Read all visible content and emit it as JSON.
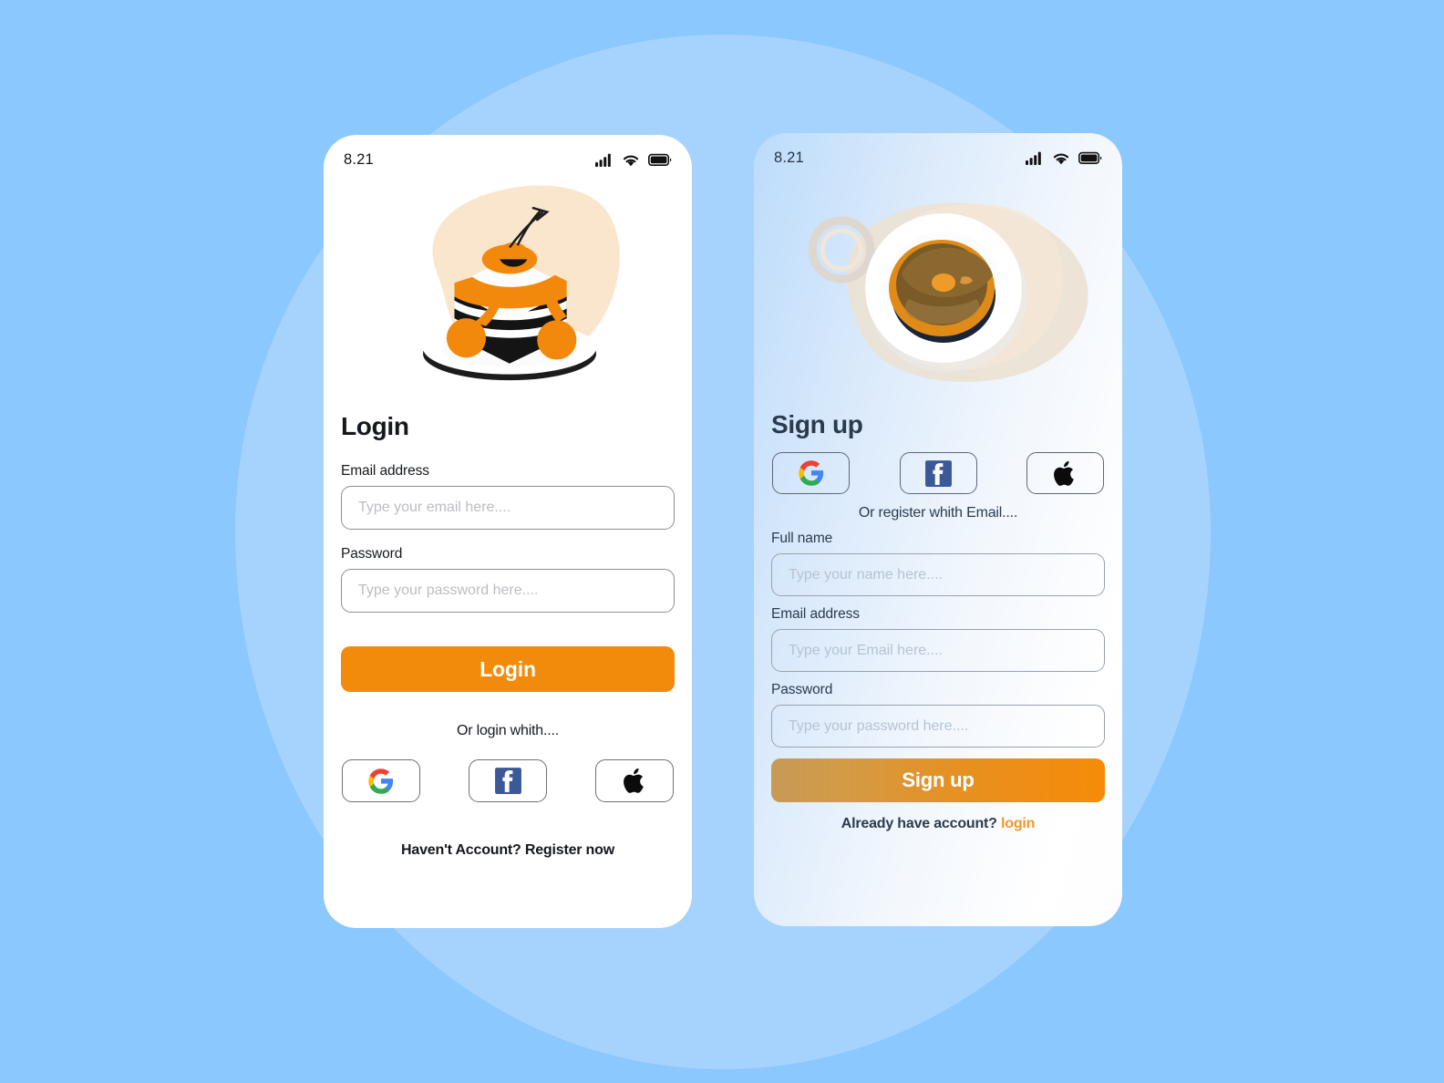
{
  "theme": {
    "page_background": "#8ac8fd",
    "background_blob": "#a5d3fd",
    "accent_orange": "#f28b0c",
    "link_orange": "#f5972a",
    "login_text": "#15181d",
    "signup_text": "#2b3b4e"
  },
  "login_screen": {
    "status_bar": {
      "time": "8.21",
      "icons": [
        "cellular-signal-icon",
        "wifi-icon",
        "battery-icon"
      ]
    },
    "illustration": {
      "name": "cake-slice-illustration",
      "description": "Layered cake slice with cherry and orange syrup on a white plate",
      "blob_color": "#fae5cd"
    },
    "title": "Login",
    "fields": [
      {
        "label": "Email address",
        "placeholder": "Type your email here....",
        "value": "",
        "type": "email"
      },
      {
        "label": "Password",
        "placeholder": "Type your password here....",
        "value": "",
        "type": "password"
      }
    ],
    "primary_button": "Login",
    "or_text": "Or login whith....",
    "social_buttons": [
      {
        "name": "google",
        "icon": "google-icon"
      },
      {
        "name": "facebook",
        "icon": "facebook-icon"
      },
      {
        "name": "apple",
        "icon": "apple-icon"
      }
    ],
    "footer_text": "Haven't Account? Register now"
  },
  "signup_screen": {
    "status_bar": {
      "time": "8.21",
      "icons": [
        "cellular-signal-icon",
        "wifi-icon",
        "battery-icon"
      ]
    },
    "illustration": {
      "name": "pancake-plate-illustration",
      "description": "Stack of pancakes with syrup on a white plate beside a cup ring",
      "blob_color": "#ece2d4"
    },
    "title": "Sign up",
    "social_buttons": [
      {
        "name": "google",
        "icon": "google-icon"
      },
      {
        "name": "facebook",
        "icon": "facebook-icon"
      },
      {
        "name": "apple",
        "icon": "apple-icon"
      }
    ],
    "or_text": "Or register whith Email....",
    "fields": [
      {
        "label": "Full name",
        "placeholder": "Type your name here....",
        "value": "",
        "type": "text"
      },
      {
        "label": "Email address",
        "placeholder": "Type your Email here....",
        "value": "",
        "type": "email"
      },
      {
        "label": "Password",
        "placeholder": "Type your password here....",
        "value": "",
        "type": "password"
      }
    ],
    "primary_button": "Sign up",
    "footer_text": "Already have account?",
    "footer_link": "login"
  }
}
